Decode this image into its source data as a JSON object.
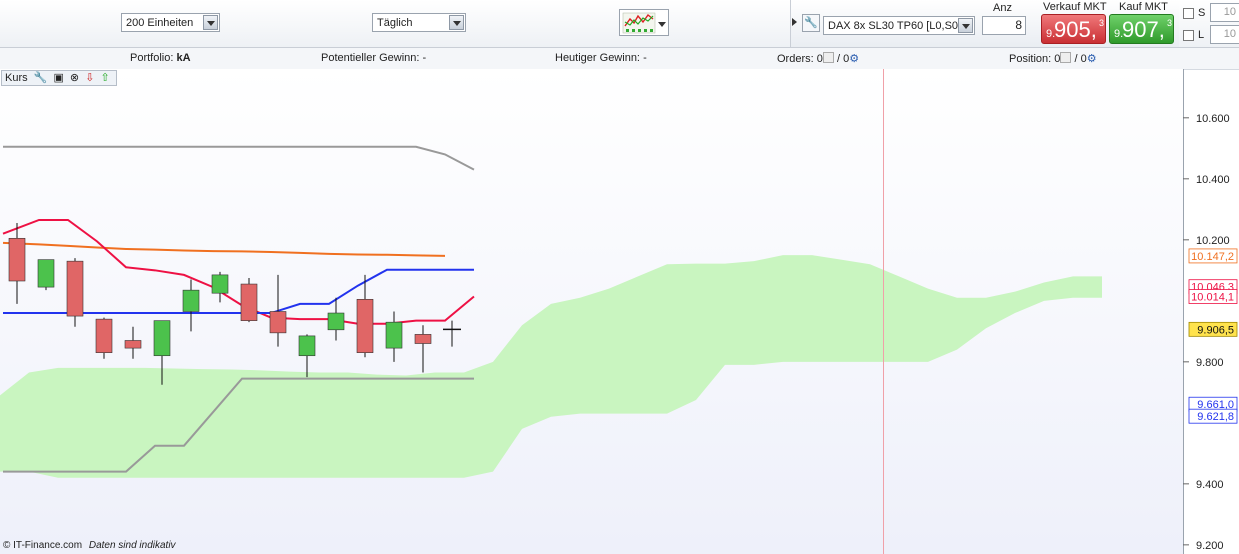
{
  "toolbar": {
    "units_select": "200 Einheiten",
    "interval_select": "Täglich"
  },
  "trade": {
    "instrument": "DAX 8x SL30 TP60 [L0,S0]",
    "anz_label": "Anz",
    "anz_value": "8",
    "sell_label": "Verkauf MKT",
    "sell_pre": "9.",
    "sell_big": "905,",
    "sell_sup": "3",
    "buy_label": "Kauf MKT",
    "buy_pre": "9.",
    "buy_big": "907,",
    "buy_sup": "3",
    "s_label": "S",
    "s_value": "10",
    "l_label": "L",
    "l_value": "10"
  },
  "info": {
    "portfolio_label": "Portfolio:",
    "portfolio_value": "kA",
    "potential_label": "Potentieller Gewinn:",
    "potential_value": "-",
    "today_label": "Heutiger Gewinn:",
    "today_value": "-",
    "orders_label": "Orders:",
    "orders_a": "0",
    "orders_sep": "/",
    "orders_b": "0",
    "position_label": "Position:",
    "position_a": "0",
    "position_sep": "/",
    "position_b": "0"
  },
  "legend": {
    "label": "Kurs"
  },
  "footer": {
    "copyright": "© IT-Finance.com",
    "note": "Daten sind indikativ"
  },
  "colors": {
    "up": "#4cc24c",
    "down": "#e06666",
    "cloud": "#c9f5c0",
    "orange": "#f07020",
    "red": "#ee1144",
    "blue": "#2233ee",
    "gray": "#999999",
    "current": "#ffe34d",
    "cursor_line": "#f0a0a8"
  },
  "chart_data": {
    "type": "candlestick",
    "ylim": [
      9170,
      10760
    ],
    "yticks": [
      "10.600",
      "10.400",
      "10.200",
      "9.800",
      "9.400",
      "9.200"
    ],
    "ytick_values": [
      10600,
      10400,
      10200,
      9800,
      9400,
      9200
    ],
    "candles": [
      {
        "open": 10205,
        "high": 10255,
        "low": 9990,
        "close": 10065
      },
      {
        "open": 10045,
        "high": 10070,
        "low": 10035,
        "close": 10135
      },
      {
        "open": 10130,
        "high": 10140,
        "low": 9915,
        "close": 9950
      },
      {
        "open": 9940,
        "high": 9945,
        "low": 9810,
        "close": 9830
      },
      {
        "open": 9870,
        "high": 9915,
        "low": 9810,
        "close": 9845
      },
      {
        "open": 9820,
        "high": 9925,
        "low": 9725,
        "close": 9935
      },
      {
        "open": 9965,
        "high": 10070,
        "low": 9900,
        "close": 10035
      },
      {
        "open": 10025,
        "high": 10095,
        "low": 9995,
        "close": 10085
      },
      {
        "open": 10055,
        "high": 10075,
        "low": 9930,
        "close": 9935
      },
      {
        "open": 9965,
        "high": 10085,
        "low": 9850,
        "close": 9895
      },
      {
        "open": 9820,
        "high": 9890,
        "low": 9750,
        "close": 9885
      },
      {
        "open": 9905,
        "high": 10010,
        "low": 9870,
        "close": 9960
      },
      {
        "open": 10005,
        "high": 10085,
        "low": 9815,
        "close": 9830
      },
      {
        "open": 9845,
        "high": 9965,
        "low": 9800,
        "close": 9930
      },
      {
        "open": 9890,
        "high": 9920,
        "low": 9765,
        "close": 9860
      },
      {
        "open": 9906.5,
        "high": 9935,
        "low": 9850,
        "close": 9906.5
      }
    ],
    "series": [
      {
        "values": [
          10190,
          10185,
          10180,
          10175,
          10170,
          10168,
          10165,
          10163,
          10162,
          10160,
          10157,
          10154,
          10152,
          10151,
          10149,
          10147.2
        ]
      },
      {
        "values": [
          10220,
          10265,
          10265,
          10195,
          10110,
          10100,
          10085,
          10045,
          9985,
          9945,
          9940,
          9940,
          9925,
          9925,
          9935,
          9935,
          10014.1
        ]
      },
      {
        "values": [
          9960,
          9960,
          9960,
          9960,
          9960,
          9960,
          9960,
          9960,
          9960,
          9960,
          9990,
          9990,
          10050,
          10102,
          10102,
          10102,
          10102
        ]
      },
      {
        "values": [
          10505,
          10505,
          10505,
          10505,
          10505,
          10505,
          10505,
          10505,
          10505,
          10505,
          10505,
          10505,
          10505,
          10505,
          10505,
          10480,
          10430
        ]
      },
      {
        "values": [
          9440,
          9440,
          9440,
          9440,
          9440,
          9525,
          9525,
          9635,
          9745,
          9745,
          9745,
          9745,
          9745,
          9745,
          9745,
          9745,
          9745
        ]
      }
    ],
    "cloud_top": [
      9690,
      9765,
      9780,
      9780,
      9780,
      9780,
      9778,
      9776,
      9775,
      9772,
      9768,
      9765,
      9765,
      9758,
      9755,
      9765,
      9765,
      9800,
      9920,
      9990,
      10010,
      10040,
      10080,
      10120,
      10122,
      10122,
      10130,
      10150,
      10150,
      10135,
      10120,
      10080,
      10040,
      10010,
      10010,
      10030,
      10060,
      10080,
      10080
    ],
    "cloud_bottom": [
      9440,
      9440,
      9420,
      9420,
      9420,
      9420,
      9420,
      9420,
      9420,
      9420,
      9420,
      9420,
      9420,
      9420,
      9420,
      9420,
      9420,
      9440,
      9580,
      9620,
      9630,
      9630,
      9630,
      9630,
      9675,
      9790,
      9790,
      9800,
      9800,
      9800,
      9800,
      9800,
      9800,
      9840,
      9910,
      9960,
      10000,
      10010,
      10010
    ],
    "price_labels": [
      {
        "value": 10147.2,
        "text": "10.147,2",
        "color": "#f07020"
      },
      {
        "value": 10046.3,
        "text": "10.046,3",
        "color": "#ee1144"
      },
      {
        "value": 10014.1,
        "text": "10.014,1",
        "color": "#ee1144"
      },
      {
        "value": 9906.5,
        "text": "9.906,5",
        "color": "#ffe34d"
      },
      {
        "value": 9661.0,
        "text": "9.661,0",
        "color": "#2233ee"
      },
      {
        "value": 9621.8,
        "text": "9.621,8",
        "color": "#2233ee"
      }
    ],
    "current_price": 9906.5
  }
}
